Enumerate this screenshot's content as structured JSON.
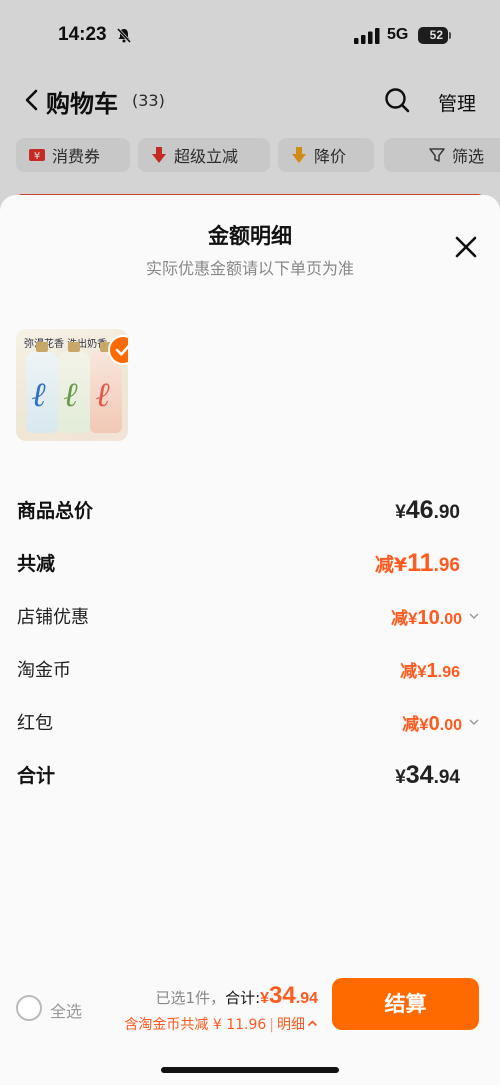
{
  "status": {
    "time": "14:23",
    "network": "5G",
    "battery": "52"
  },
  "header": {
    "title": "购物车",
    "count": "(33)",
    "manage": "管理"
  },
  "filters": [
    {
      "label": "消费券"
    },
    {
      "label": "超级立减"
    },
    {
      "label": "降价"
    },
    {
      "label": "筛选"
    }
  ],
  "sheet": {
    "title": "金额明细",
    "subtitle": "实际优惠金额请以下单页为准",
    "product": {
      "banner": "弥漫花香 洗出奶香"
    },
    "rows": {
      "subtotal": {
        "label": "商品总价",
        "currency": "¥",
        "int": "46",
        "dec": ".90"
      },
      "total_discount": {
        "label": "共减",
        "prefix": "减¥",
        "int": "11",
        "dec": ".96"
      },
      "store_discount": {
        "label": "店铺优惠",
        "prefix": "减¥",
        "int": "10",
        "dec": ".00"
      },
      "coins": {
        "label": "淘金币",
        "prefix": "减¥",
        "int": "1",
        "dec": ".96"
      },
      "red_packet": {
        "label": "红包",
        "prefix": "减¥",
        "int": "0",
        "dec": ".00"
      },
      "total": {
        "label": "合计",
        "currency": "¥",
        "int": "34",
        "dec": ".94"
      }
    }
  },
  "bottom": {
    "select_all": "全选",
    "selected_text": "已选1件，",
    "total_label": "合计:",
    "total_currency": "¥",
    "total_int": "34",
    "total_dec": ".94",
    "discount_text": "含淘金币共减 ¥ 11.96",
    "detail_label": "明细",
    "checkout": "结算"
  },
  "colors": {
    "accent": "#ff6a00",
    "discount": "#ff5a1f"
  }
}
